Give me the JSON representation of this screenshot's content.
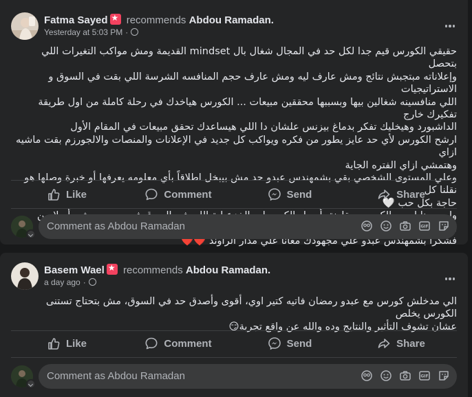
{
  "posts": [
    {
      "author": "Fatma Sayed",
      "action": "recommends",
      "page": "Abdou Ramadan.",
      "time": "Yesterday at 5:03 PM",
      "lines": [
        "حقيقي الكورس قيم جدا لكل حد في المجال شغال بال mindset القديمة ومش مواكب التغيرات اللي بتحصل",
        "وإعلاناته مبتجبش نتائج ومش عارف ليه ومش عارف حجم المنافسه الشرسة اللي بقت في السوق و الاستراتيجيات",
        "اللي منافسينه شغالين بيها وبسببها محققين مبيعات ... الكورس هياخدك في رحلة كاملة من اول طريقة تفكيرك خارج",
        "الداشبورد وهيخليك تفكر بدماغ بيزنس علشان دا اللي هيساعدك تحقق مبيعات في المقام الأول",
        "ارشح الكورس لأي حد عايز يطور من فكره ويواكب كل جديد في الإعلانات والمنصات والالجورزم بقت ماشيه ازاي",
        "وهتمشي ازاي الفتره الجاية",
        "وعلي المستوى الشخصي بقي بشمهندس عبدو حد مش بيبخل اطلاقاً بأي معلومه يعرفها أو خبرة وصلها هو نقلنا كل",
        "حاجة بكل حب 🤍",
        "ولو بصينا لسعر الكورس مقارنة بأسعار الكورسات الخزعبلية اللي في السوق فهو سعر سيشن أصلا من الكورسات دي",
        "فشكرا بشمهندس عبدو علي مجهودك معانا علي مدار الراوند ❤️❤️"
      ]
    },
    {
      "author": "Basem Wael",
      "action": "recommends",
      "page": "Abdou Ramadan.",
      "time": "a day ago",
      "lines": [
        "الي مدخلش كورس مع عبدو رمضان فاتيه كتير اوي، أقوى وأصدق حد في السوق، مش بتحتاج تستنى الكورس يخلص",
        "عشان تشوف التأثير والنتايج وده والله عن واقع تجربة😏"
      ]
    }
  ],
  "actions": {
    "like": "Like",
    "comment": "Comment",
    "send": "Send",
    "share": "Share"
  },
  "comment_placeholder": "Comment as Abdou Ramadan"
}
